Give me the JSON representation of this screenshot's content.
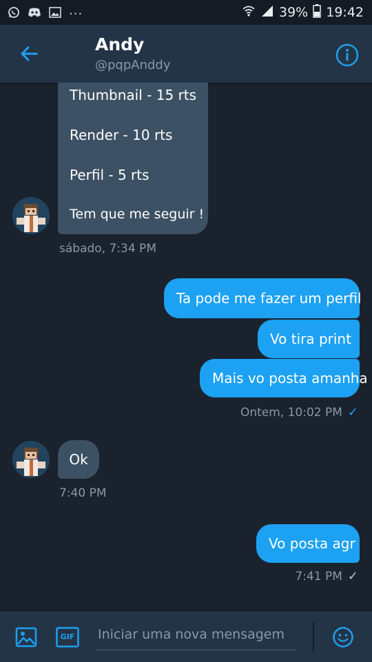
{
  "status_bar": {
    "left_icons": [
      "whatsapp-icon",
      "discord-icon",
      "gallery-icon"
    ],
    "overflow": "...",
    "battery": "39%",
    "time": "19:42"
  },
  "header": {
    "name": "Andy",
    "handle": "@pqpAnddy",
    "back_icon": "back-arrow-icon",
    "info_icon": "info-icon"
  },
  "messages": {
    "incoming_list": {
      "lines": [
        "Thumbnail - 15 rts",
        "Render - 10 rts",
        "Perfil - 5 rts",
        "Tem que me seguir !"
      ],
      "timestamp": "sábado, 7:34 PM"
    },
    "outgoing_group": {
      "bubbles": [
        "Ta pode me fazer um perfil",
        "Vo tira print",
        "Mais vo posta amanha"
      ],
      "timestamp": "Ontem, 10:02 PM"
    },
    "incoming_ok": {
      "text": "Ok",
      "timestamp": "7:40 PM"
    },
    "outgoing_last": {
      "text": "Vo posta agr",
      "timestamp": "7:41 PM"
    }
  },
  "composer": {
    "placeholder": "Iniciar uma nova mensagem",
    "gif_label": "GIF",
    "image_icon": "image-icon",
    "emoji_icon": "emoji-icon"
  },
  "colors": {
    "background": "#1a222d",
    "header": "#243447",
    "accent": "#1da1f2",
    "incoming_bubble": "#3d5164",
    "muted_text": "#8899a6"
  }
}
